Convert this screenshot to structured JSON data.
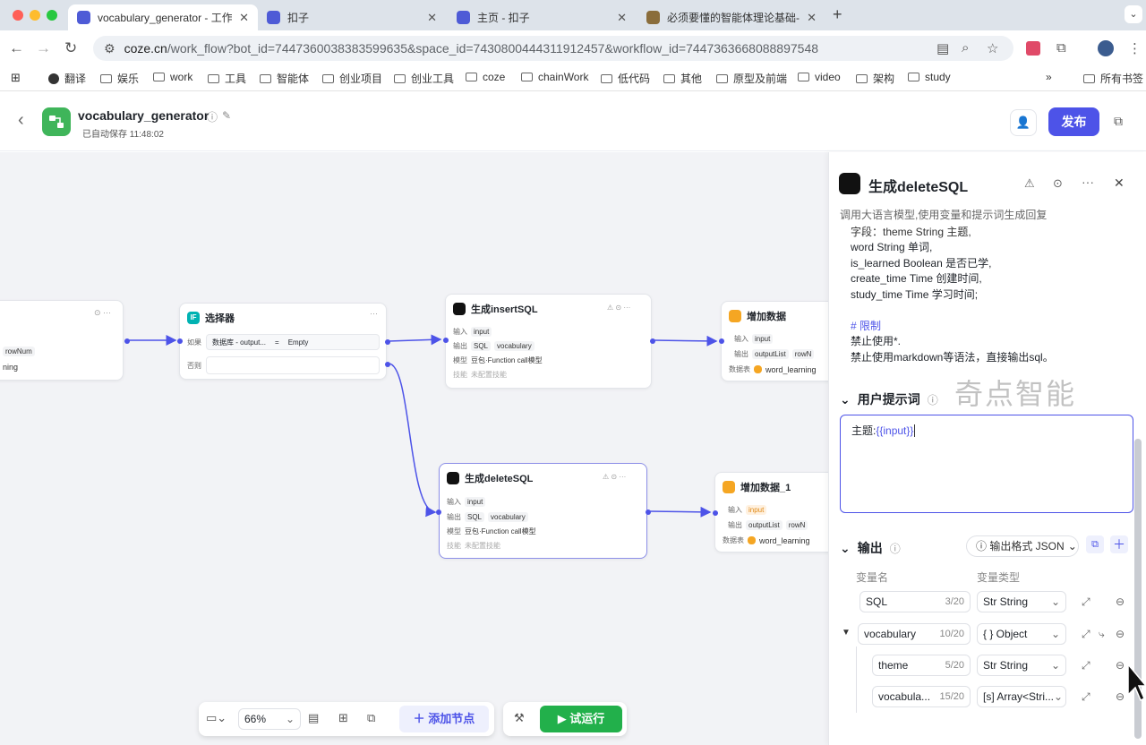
{
  "browser": {
    "tabs": [
      {
        "title": "vocabulary_generator - 工作流",
        "active": true
      },
      {
        "title": "扣子",
        "active": false
      },
      {
        "title": "主页 - 扣子",
        "active": false
      },
      {
        "title": "必须要懂的智能体理论基础-子",
        "active": false
      }
    ],
    "new_tab": "+",
    "url_host": "coze.cn",
    "url_path": "/work_flow?bot_id=7447360038383599635&space_id=7430800444311912457&workflow_id=7447363668088897548",
    "bookmarks": [
      "翻译",
      "娱乐",
      "work",
      "工具",
      "智能体",
      "创业项目",
      "创业工具",
      "coze",
      "chainWork",
      "低代码",
      "其他",
      "原型及前端",
      "video",
      "架构",
      "study"
    ],
    "bookmarks_more": "»",
    "all_bookmarks": "所有书签"
  },
  "header": {
    "back": "‹",
    "title": "vocabulary_generator",
    "autosave": "已自动保存 11:48:02",
    "publish": "发布",
    "brand_color": "#4d53e8",
    "logo_color": "#3fb55a"
  },
  "nodes": {
    "left_partial": {
      "row1": "rowNum",
      "row2": "ning"
    },
    "selector": {
      "title": "选择器",
      "if_label": "如果",
      "cond_a": "数据库 - output...",
      "op": "=",
      "cond_b": "Empty",
      "else_label": "否则"
    },
    "insert_sql": {
      "title": "生成insertSQL",
      "in_label": "输入",
      "in_val": "input",
      "out_label": "输出",
      "out_a": "SQL",
      "out_b": "vocabulary",
      "model_label": "模型",
      "model_val": "豆包·Function call模型",
      "skill_label": "技能",
      "skill_val": "未配置技能"
    },
    "add_data": {
      "title": "增加数据",
      "in_label": "输入",
      "in_val": "input",
      "out_label": "输出",
      "out_val": "outputList",
      "out_more": "rowN",
      "db_label": "数据表",
      "db_val": "word_learning"
    },
    "delete_sql": {
      "title": "生成deleteSQL",
      "in_label": "输入",
      "in_val": "input",
      "out_label": "输出",
      "out_a": "SQL",
      "out_b": "vocabulary",
      "model_label": "模型",
      "model_val": "豆包·Function call模型",
      "skill_label": "技能",
      "skill_val": "未配置技能"
    },
    "add_data_1": {
      "title": "增加数据_1",
      "in_label": "输入",
      "in_val": "input",
      "out_label": "输出",
      "out_val": "outputList",
      "out_more": "rowN",
      "db_label": "数据表",
      "db_val": "word_learning"
    }
  },
  "toolbar": {
    "zoom": "66%",
    "add_node": "添加节点",
    "test_run": "试运行"
  },
  "panel": {
    "title": "生成deleteSQL",
    "desc": "调用大语言模型,使用变量和提示词生成回复",
    "prompt_lines": [
      "字段：theme String  主题,",
      "word String  单词,",
      "is_learned Boolean  是否已学,",
      "create_time Time  创建时间,",
      "study_time Time  学习时间;",
      "",
      "# 限制",
      "禁止使用*.",
      "禁止使用markdown等语法，直接输出sql。"
    ],
    "watermark": "奇点智能",
    "user_prompt_title": "用户提示词",
    "user_prompt_prefix": "主题:",
    "user_prompt_var": "{{input}}",
    "output_title": "输出",
    "output_format": "输出格式 JSON",
    "col_name": "变量名",
    "col_type": "变量类型",
    "vars": [
      {
        "name": "SQL",
        "count": "3/20",
        "type": "Str String",
        "indent": 0
      },
      {
        "name": "vocabulary",
        "count": "10/20",
        "type": "{ } Object",
        "indent": 0
      },
      {
        "name": "theme",
        "count": "5/20",
        "type": "Str String",
        "indent": 1
      },
      {
        "name": "vocabula...",
        "count": "15/20",
        "type": "[s] Array<Stri...",
        "indent": 1
      }
    ]
  }
}
